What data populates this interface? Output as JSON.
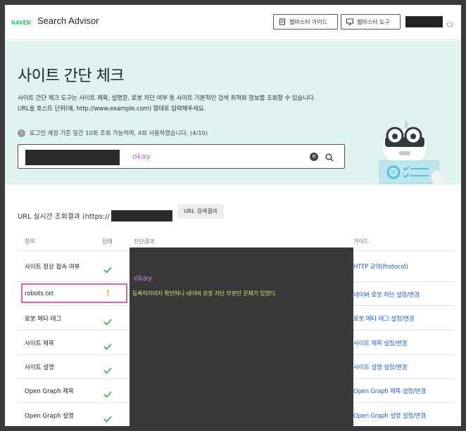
{
  "header": {
    "logo": "NAVER",
    "brand": "Search Advisor",
    "buttons": [
      {
        "label": "웹마스터 가이드",
        "icon": "book-icon"
      },
      {
        "label": "웹마스터 도구",
        "icon": "monitor-icon"
      }
    ],
    "power_icon": "power-icon"
  },
  "hero": {
    "title": "사이트 간단 체크",
    "desc_line1": "사이트 간단 체크 도구는 사이트 제목, 설명문, 로봇 차단 여부 등 사이트 기본적인 검색 최적화 정보를 조회할 수 있습니다.",
    "desc_line2": "URL을 호스트 단위(예, http://www.example.com) 형태로 입력해주세요.",
    "notice": "로그인 계정 기준 일간 10회 조회 가능하며, 4회 사용하였습니다. (4/10)",
    "notice_icon": "info-icon",
    "search_value": "okay"
  },
  "results": {
    "title_prefix": "URL 실시간 조회결과 (https://",
    "button": "URL 검색결과",
    "headers": {
      "item": "항목",
      "status": "상태",
      "diagnosis": "진단결과",
      "guide": "가이드"
    },
    "rows": [
      {
        "label": "사이트 정상 접속 여부",
        "status": "ok",
        "guide": "HTTP 규약(Protocol)"
      },
      {
        "label": "robots.txt",
        "status": "warn",
        "guide": "네이버 로봇 차단 설정/변경"
      },
      {
        "label": "로봇 메타 태그",
        "status": "ok",
        "guide": "로봇 메타 태그 설정/변경"
      },
      {
        "label": "사이트 제목",
        "status": "ok",
        "guide": "사이트 제목 설정/변경"
      },
      {
        "label": "사이트 설명",
        "status": "ok",
        "guide": "사이트 설명 설정/변경"
      },
      {
        "label": "Open Graph 제목",
        "status": "ok",
        "guide": "Open Graph 제목 설정/변경"
      },
      {
        "label": "Open Graph 설명",
        "status": "ok",
        "guide": "Open Graph 설명 설정/변경"
      }
    ],
    "warn_symbol": "!",
    "diagnosis_okay": "okay",
    "diagnosis_message": "등록하자마자 확인하니 네이버 로봇 차단 부분만 문제가 있었다."
  },
  "colors": {
    "accent": "#03c75a",
    "hero_bg": "#dff3f1",
    "link": "#1a5cd6",
    "highlight": "#e55fa7"
  }
}
